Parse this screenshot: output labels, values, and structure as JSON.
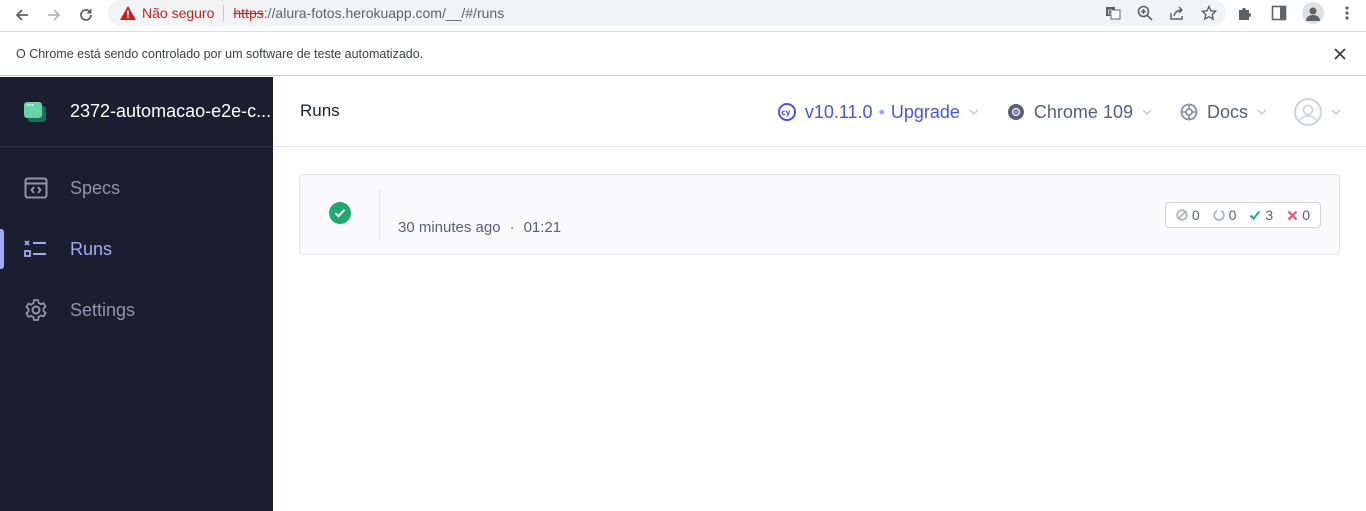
{
  "browser": {
    "security_label": "Não seguro",
    "url_scheme": "https",
    "url_rest": "://alura-fotos.herokuapp.com/__/#/runs",
    "infobar_text": "O Chrome está sendo controlado por um software de teste automatizado."
  },
  "sidebar": {
    "project_name": "2372-automacao-e2e-c...",
    "items": [
      {
        "label": "Specs",
        "icon": "specs-icon",
        "active": false
      },
      {
        "label": "Runs",
        "icon": "runs-icon",
        "active": true
      },
      {
        "label": "Settings",
        "icon": "gear-icon",
        "active": false
      }
    ]
  },
  "header": {
    "title": "Runs",
    "version": "v10.11.0",
    "upgrade": "Upgrade",
    "browser": "Chrome 109",
    "docs": "Docs"
  },
  "runs": [
    {
      "status": "passed",
      "time_ago": "30 minutes ago",
      "duration": "01:21",
      "skipped": "0",
      "pending": "0",
      "passed": "3",
      "failed": "0"
    }
  ],
  "colors": {
    "sidebar_bg": "#1b1e2e",
    "accent": "#4956e3",
    "active_nav": "#a3a9f5",
    "passed": "#1fa971",
    "failed": "#e45770"
  }
}
